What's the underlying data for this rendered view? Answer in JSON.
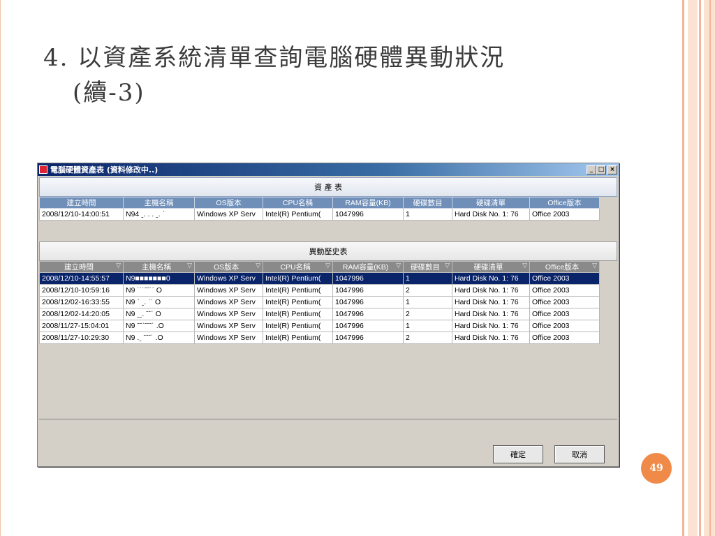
{
  "slide": {
    "title_line1": "4. 以資產系統清單查詢電腦硬體異動狀況",
    "title_line2": "(續-3)",
    "page_number": "49"
  },
  "window": {
    "title": "電腦硬體資產表 (資料修改中..)",
    "minimize": "_",
    "maximize": "□",
    "close": "×"
  },
  "asset_panel": {
    "title": "資 產 表",
    "columns": [
      "建立時間",
      "主機名稱",
      "OS版本",
      "CPU名稱",
      "RAM容量(KB)",
      "硬碟數目",
      "硬碟清單",
      "Office版本"
    ],
    "rows": [
      [
        "2008/12/10-14:00:51",
        "N94 ˍ. . . ˍ. ˈ",
        "Windows XP Serv",
        "Intel(R) Pentium(",
        "1047996",
        "1",
        "Hard Disk No. 1: 76",
        "Office 2003"
      ]
    ]
  },
  "history_panel": {
    "title": "異動歷史表",
    "columns": [
      "建立時間",
      "主機名稱",
      "OS版本",
      "CPU名稱",
      "RAM容量(KB)",
      "硬碟數目",
      "硬碟清單",
      "Office版本"
    ],
    "filter_icon": "▽",
    "selected_row": 0,
    "rows": [
      [
        "2008/12/10-14:55:57",
        "N9■■■■■■■0",
        "Windows XP Serv",
        "Intel(R) Pentium(",
        "1047996",
        "1",
        "Hard Disk No. 1: 76",
        "Office 2003"
      ],
      [
        "2008/12/10-10:59:16",
        "N9  ˙˙˙ˉˉ˙ˈ O",
        "Windows XP Serv",
        "Intel(R) Pentium(",
        "1047996",
        "2",
        "Hard Disk No. 1: 76",
        "Office 2003"
      ],
      [
        "2008/12/02-16:33:55",
        "N9 ˈ ˍ.  ˈˈ O",
        "Windows XP Serv",
        "Intel(R) Pentium(",
        "1047996",
        "1",
        "Hard Disk No. 1: 76",
        "Office 2003"
      ],
      [
        "2008/12/02-14:20:05",
        "N9  ˍˍ. ˉˉˈ O",
        "Windows XP Serv",
        "Intel(R) Pentium(",
        "1047996",
        "2",
        "Hard Disk No. 1: 76",
        "Office 2003"
      ],
      [
        "2008/11/27-15:04:01",
        "N9 ˉˉˈˉˉˉ˙ .O",
        "Windows XP Serv",
        "Intel(R) Pentium(",
        "1047996",
        "1",
        "Hard Disk No. 1: 76",
        "Office 2003"
      ],
      [
        "2008/11/27-10:29:30",
        "N9 .ˍ ˉˉˉ˙ .O",
        "Windows XP Serv",
        "Intel(R) Pentium(",
        "1047996",
        "2",
        "Hard Disk No. 1: 76",
        "Office 2003"
      ]
    ]
  },
  "buttons": {
    "ok": "確定",
    "cancel": "取消"
  },
  "colors": {
    "accent": "#f08a48",
    "selected_row": "#0a246a",
    "asset_header": "#6f8fb9",
    "history_header": "#8a8a8a"
  }
}
